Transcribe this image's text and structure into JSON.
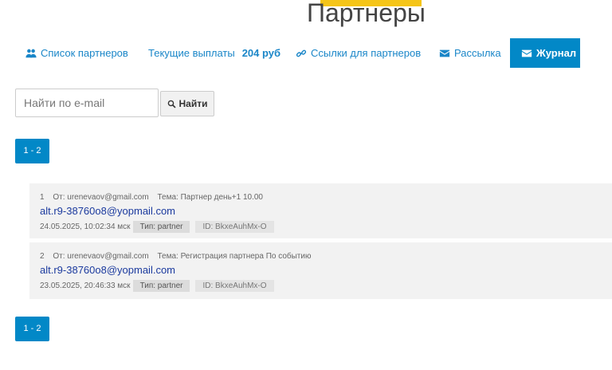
{
  "page_title": "Партнеры",
  "nav": {
    "partners_list": "Список партнеров",
    "payouts_label": "Текущие выплаты",
    "payouts_amount": "204 руб",
    "links": "Ссылки для партнеров",
    "mailing": "Рассылка",
    "journal": "Журнал"
  },
  "search": {
    "placeholder": "Найти по e-mail",
    "button": "Найти"
  },
  "pagination": {
    "label": "1 - 2"
  },
  "log": [
    {
      "index": "1",
      "from": "От: urenevaov@gmail.com",
      "subject": "Тема: Партнер день+1 10.00",
      "email": "alt.r9-38760o8@yopmail.com",
      "datetime": "24.05.2025, 10:02:34 мск",
      "type": "Тип: partner",
      "id": "ID: BkxeAuhMx-O"
    },
    {
      "index": "2",
      "from": "От: urenevaov@gmail.com",
      "subject": "Тема: Регистрация партнера По событию",
      "email": "alt.r9-38760o8@yopmail.com",
      "datetime": "23.05.2025, 20:46:33 мск",
      "type": "Тип: partner",
      "id": "ID: BkxeAuhMx-O"
    }
  ],
  "colors": {
    "accent": "#0288c7",
    "link": "#1a86c8",
    "email": "#1b3a9e",
    "tab": "#f5c518"
  },
  "icons": [
    "users-icon",
    "link-icon",
    "envelope-icon",
    "search-icon"
  ]
}
